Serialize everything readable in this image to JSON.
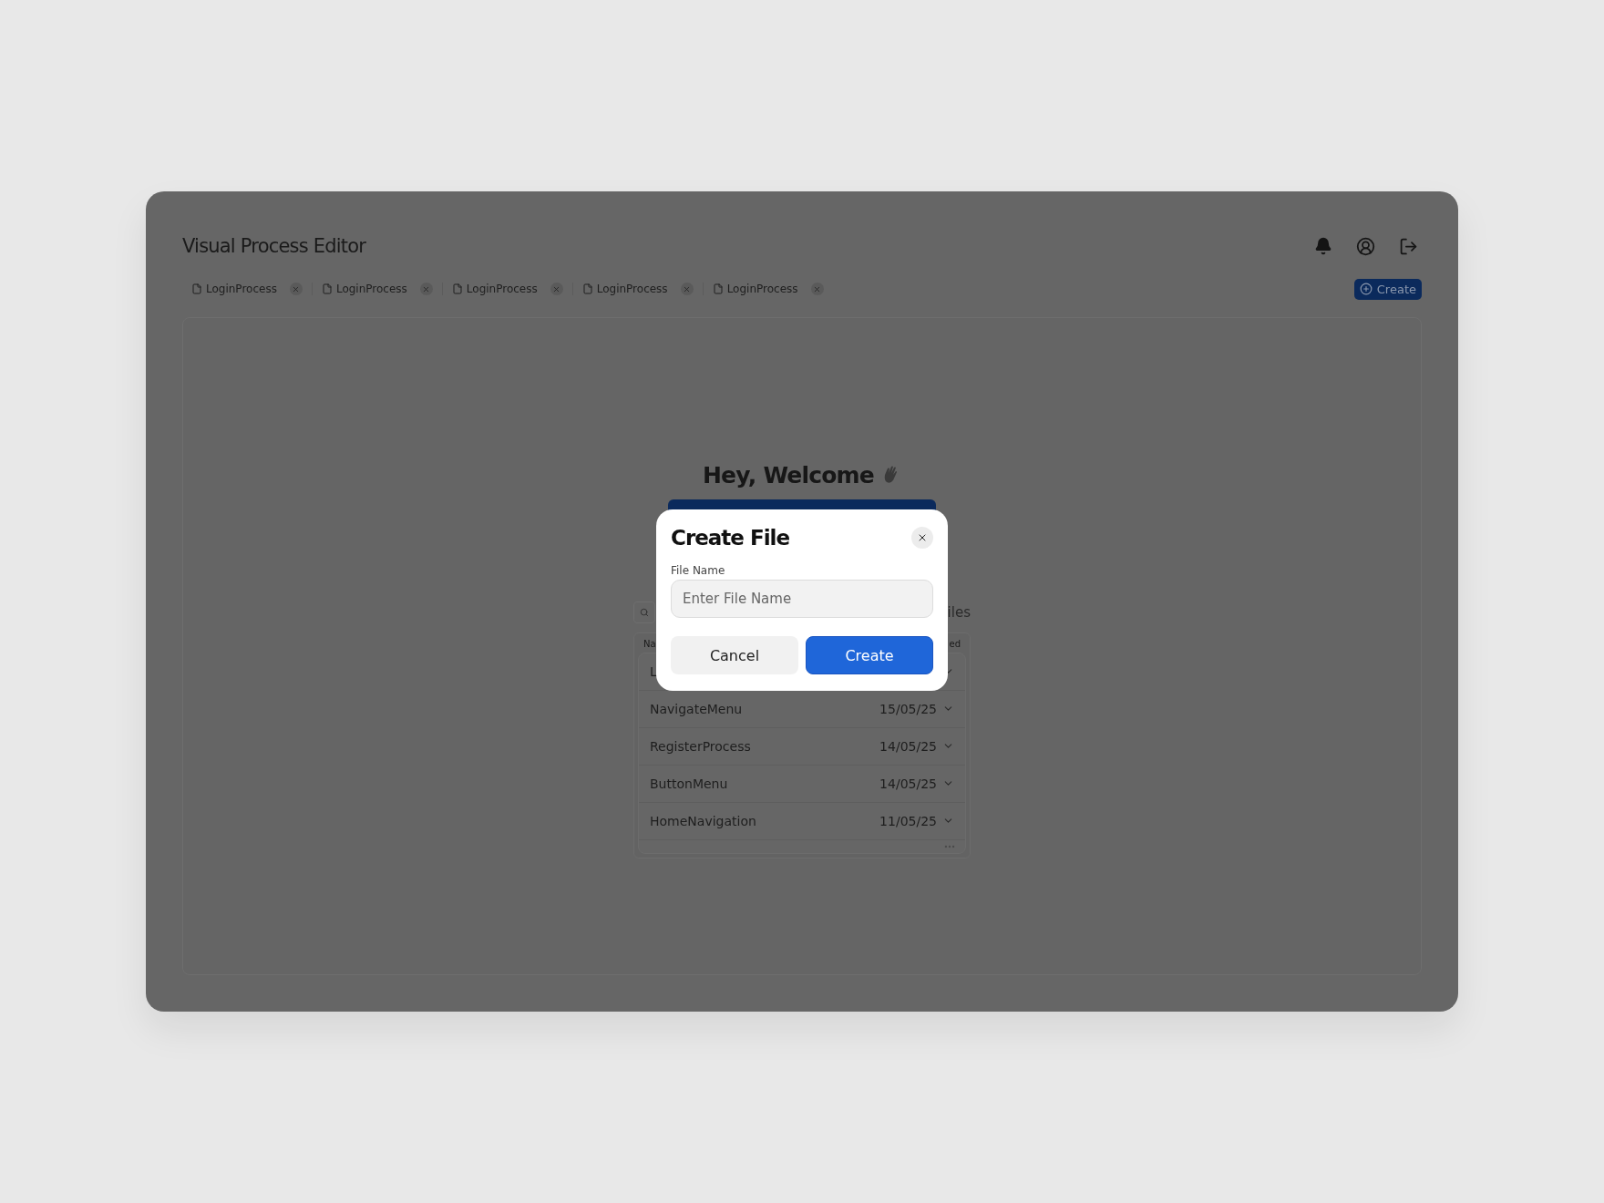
{
  "app": {
    "title": "Visual Process Editor"
  },
  "tabs": [
    {
      "label": "LoginProcess"
    },
    {
      "label": "LoginProcess"
    },
    {
      "label": "LoginProcess"
    },
    {
      "label": "LoginProcess"
    },
    {
      "label": "LoginProcess"
    }
  ],
  "create_button": {
    "label": "Create"
  },
  "welcome": {
    "heading": "Hey, Welcome"
  },
  "search": {
    "trailing_text": "iles"
  },
  "file_list": {
    "columns": [
      "Na",
      "ed"
    ],
    "rows": [
      {
        "name": "L"
      },
      {
        "name": "NavigateMenu",
        "date": "15/05/25"
      },
      {
        "name": "RegisterProcess",
        "date": "14/05/25"
      },
      {
        "name": "ButtonMenu",
        "date": "14/05/25"
      },
      {
        "name": "HomeNavigation",
        "date": "11/05/25"
      }
    ]
  },
  "dialog": {
    "title": "Create File",
    "field_label": "File Name",
    "placeholder": "Enter File Name",
    "buttons": [
      {
        "label": "Cancel",
        "kind": "secondary"
      },
      {
        "label": "Create",
        "kind": "primary"
      }
    ]
  }
}
